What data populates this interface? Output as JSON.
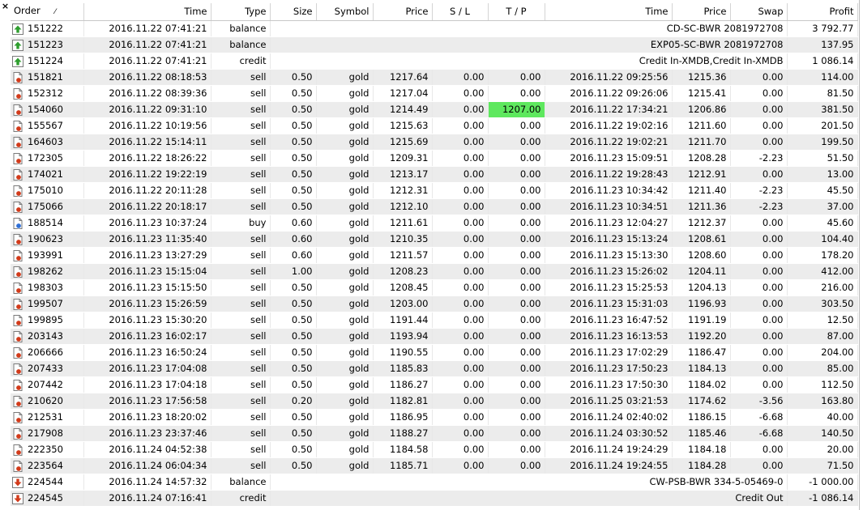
{
  "columns": {
    "order": "Order",
    "open_time": "Time",
    "type": "Type",
    "size": "Size",
    "symbol": "Symbol",
    "open_price": "Price",
    "sl": "S / L",
    "tp": "T / P",
    "close_time": "Time",
    "close_price": "Price",
    "swap": "Swap",
    "profit": "Profit"
  },
  "close_icon": "×",
  "rows": [
    {
      "kind": "balance-in",
      "order": "151222",
      "open_time": "2016.11.22 07:41:21",
      "type": "balance",
      "comment": "CD-SC-BWR 2081972708",
      "profit": "3 792.77"
    },
    {
      "kind": "balance-in",
      "order": "151223",
      "open_time": "2016.11.22 07:41:21",
      "type": "balance",
      "comment": "EXP05-SC-BWR 2081972708",
      "profit": "137.95"
    },
    {
      "kind": "balance-in",
      "order": "151224",
      "open_time": "2016.11.22 07:41:21",
      "type": "credit",
      "comment": "Credit In-XMDB,Credit In-XMDB",
      "profit": "1 086.14"
    },
    {
      "kind": "sell",
      "order": "151821",
      "open_time": "2016.11.22 08:18:53",
      "type": "sell",
      "size": "0.50",
      "symbol": "gold",
      "open_price": "1217.64",
      "sl": "0.00",
      "tp": "0.00",
      "close_time": "2016.11.22 09:25:56",
      "close_price": "1215.36",
      "swap": "0.00",
      "profit": "114.00"
    },
    {
      "kind": "sell",
      "order": "152312",
      "open_time": "2016.11.22 08:39:36",
      "type": "sell",
      "size": "0.50",
      "symbol": "gold",
      "open_price": "1217.04",
      "sl": "0.00",
      "tp": "0.00",
      "close_time": "2016.11.22 09:26:06",
      "close_price": "1215.41",
      "swap": "0.00",
      "profit": "81.50"
    },
    {
      "kind": "sell",
      "order": "154060",
      "open_time": "2016.11.22 09:31:10",
      "type": "sell",
      "size": "0.50",
      "symbol": "gold",
      "open_price": "1214.49",
      "sl": "0.00",
      "tp": "1207.00",
      "close_time": "2016.11.22 17:34:21",
      "close_price": "1206.86",
      "swap": "0.00",
      "profit": "381.50",
      "tp_hit": true
    },
    {
      "kind": "sell",
      "order": "155567",
      "open_time": "2016.11.22 10:19:56",
      "type": "sell",
      "size": "0.50",
      "symbol": "gold",
      "open_price": "1215.63",
      "sl": "0.00",
      "tp": "0.00",
      "close_time": "2016.11.22 19:02:16",
      "close_price": "1211.60",
      "swap": "0.00",
      "profit": "201.50"
    },
    {
      "kind": "sell",
      "order": "164603",
      "open_time": "2016.11.22 15:14:11",
      "type": "sell",
      "size": "0.50",
      "symbol": "gold",
      "open_price": "1215.69",
      "sl": "0.00",
      "tp": "0.00",
      "close_time": "2016.11.22 19:02:21",
      "close_price": "1211.70",
      "swap": "0.00",
      "profit": "199.50"
    },
    {
      "kind": "sell",
      "order": "172305",
      "open_time": "2016.11.22 18:26:22",
      "type": "sell",
      "size": "0.50",
      "symbol": "gold",
      "open_price": "1209.31",
      "sl": "0.00",
      "tp": "0.00",
      "close_time": "2016.11.23 15:09:51",
      "close_price": "1208.28",
      "swap": "-2.23",
      "profit": "51.50"
    },
    {
      "kind": "sell",
      "order": "174021",
      "open_time": "2016.11.22 19:22:19",
      "type": "sell",
      "size": "0.50",
      "symbol": "gold",
      "open_price": "1213.17",
      "sl": "0.00",
      "tp": "0.00",
      "close_time": "2016.11.22 19:28:43",
      "close_price": "1212.91",
      "swap": "0.00",
      "profit": "13.00"
    },
    {
      "kind": "sell",
      "order": "175010",
      "open_time": "2016.11.22 20:11:28",
      "type": "sell",
      "size": "0.50",
      "symbol": "gold",
      "open_price": "1212.31",
      "sl": "0.00",
      "tp": "0.00",
      "close_time": "2016.11.23 10:34:42",
      "close_price": "1211.40",
      "swap": "-2.23",
      "profit": "45.50"
    },
    {
      "kind": "sell",
      "order": "175066",
      "open_time": "2016.11.22 20:18:17",
      "type": "sell",
      "size": "0.50",
      "symbol": "gold",
      "open_price": "1212.10",
      "sl": "0.00",
      "tp": "0.00",
      "close_time": "2016.11.23 10:34:51",
      "close_price": "1211.36",
      "swap": "-2.23",
      "profit": "37.00"
    },
    {
      "kind": "buy",
      "order": "188514",
      "open_time": "2016.11.23 10:37:24",
      "type": "buy",
      "size": "0.60",
      "symbol": "gold",
      "open_price": "1211.61",
      "sl": "0.00",
      "tp": "0.00",
      "close_time": "2016.11.23 12:04:27",
      "close_price": "1212.37",
      "swap": "0.00",
      "profit": "45.60"
    },
    {
      "kind": "sell",
      "order": "190623",
      "open_time": "2016.11.23 11:35:40",
      "type": "sell",
      "size": "0.60",
      "symbol": "gold",
      "open_price": "1210.35",
      "sl": "0.00",
      "tp": "0.00",
      "close_time": "2016.11.23 15:13:24",
      "close_price": "1208.61",
      "swap": "0.00",
      "profit": "104.40"
    },
    {
      "kind": "sell",
      "order": "193991",
      "open_time": "2016.11.23 13:27:29",
      "type": "sell",
      "size": "0.60",
      "symbol": "gold",
      "open_price": "1211.57",
      "sl": "0.00",
      "tp": "0.00",
      "close_time": "2016.11.23 15:13:30",
      "close_price": "1208.60",
      "swap": "0.00",
      "profit": "178.20"
    },
    {
      "kind": "sell",
      "order": "198262",
      "open_time": "2016.11.23 15:15:04",
      "type": "sell",
      "size": "1.00",
      "symbol": "gold",
      "open_price": "1208.23",
      "sl": "0.00",
      "tp": "0.00",
      "close_time": "2016.11.23 15:26:02",
      "close_price": "1204.11",
      "swap": "0.00",
      "profit": "412.00"
    },
    {
      "kind": "sell",
      "order": "198303",
      "open_time": "2016.11.23 15:15:50",
      "type": "sell",
      "size": "0.50",
      "symbol": "gold",
      "open_price": "1208.45",
      "sl": "0.00",
      "tp": "0.00",
      "close_time": "2016.11.23 15:25:53",
      "close_price": "1204.13",
      "swap": "0.00",
      "profit": "216.00"
    },
    {
      "kind": "sell",
      "order": "199507",
      "open_time": "2016.11.23 15:26:59",
      "type": "sell",
      "size": "0.50",
      "symbol": "gold",
      "open_price": "1203.00",
      "sl": "0.00",
      "tp": "0.00",
      "close_time": "2016.11.23 15:31:03",
      "close_price": "1196.93",
      "swap": "0.00",
      "profit": "303.50"
    },
    {
      "kind": "sell",
      "order": "199895",
      "open_time": "2016.11.23 15:30:20",
      "type": "sell",
      "size": "0.50",
      "symbol": "gold",
      "open_price": "1191.44",
      "sl": "0.00",
      "tp": "0.00",
      "close_time": "2016.11.23 16:47:52",
      "close_price": "1191.19",
      "swap": "0.00",
      "profit": "12.50"
    },
    {
      "kind": "sell",
      "order": "203143",
      "open_time": "2016.11.23 16:02:17",
      "type": "sell",
      "size": "0.50",
      "symbol": "gold",
      "open_price": "1193.94",
      "sl": "0.00",
      "tp": "0.00",
      "close_time": "2016.11.23 16:13:53",
      "close_price": "1192.20",
      "swap": "0.00",
      "profit": "87.00"
    },
    {
      "kind": "sell",
      "order": "206666",
      "open_time": "2016.11.23 16:50:24",
      "type": "sell",
      "size": "0.50",
      "symbol": "gold",
      "open_price": "1190.55",
      "sl": "0.00",
      "tp": "0.00",
      "close_time": "2016.11.23 17:02:29",
      "close_price": "1186.47",
      "swap": "0.00",
      "profit": "204.00"
    },
    {
      "kind": "sell",
      "order": "207433",
      "open_time": "2016.11.23 17:04:08",
      "type": "sell",
      "size": "0.50",
      "symbol": "gold",
      "open_price": "1185.83",
      "sl": "0.00",
      "tp": "0.00",
      "close_time": "2016.11.23 17:50:23",
      "close_price": "1184.13",
      "swap": "0.00",
      "profit": "85.00"
    },
    {
      "kind": "sell",
      "order": "207442",
      "open_time": "2016.11.23 17:04:18",
      "type": "sell",
      "size": "0.50",
      "symbol": "gold",
      "open_price": "1186.27",
      "sl": "0.00",
      "tp": "0.00",
      "close_time": "2016.11.23 17:50:30",
      "close_price": "1184.02",
      "swap": "0.00",
      "profit": "112.50"
    },
    {
      "kind": "sell",
      "order": "210620",
      "open_time": "2016.11.23 17:56:58",
      "type": "sell",
      "size": "0.20",
      "symbol": "gold",
      "open_price": "1182.81",
      "sl": "0.00",
      "tp": "0.00",
      "close_time": "2016.11.25 03:21:53",
      "close_price": "1174.62",
      "swap": "-3.56",
      "profit": "163.80"
    },
    {
      "kind": "sell",
      "order": "212531",
      "open_time": "2016.11.23 18:20:02",
      "type": "sell",
      "size": "0.50",
      "symbol": "gold",
      "open_price": "1186.95",
      "sl": "0.00",
      "tp": "0.00",
      "close_time": "2016.11.24 02:40:02",
      "close_price": "1186.15",
      "swap": "-6.68",
      "profit": "40.00"
    },
    {
      "kind": "sell",
      "order": "217908",
      "open_time": "2016.11.23 23:37:46",
      "type": "sell",
      "size": "0.50",
      "symbol": "gold",
      "open_price": "1188.27",
      "sl": "0.00",
      "tp": "0.00",
      "close_time": "2016.11.24 03:30:52",
      "close_price": "1185.46",
      "swap": "-6.68",
      "profit": "140.50"
    },
    {
      "kind": "sell",
      "order": "222350",
      "open_time": "2016.11.24 04:52:38",
      "type": "sell",
      "size": "0.50",
      "symbol": "gold",
      "open_price": "1184.58",
      "sl": "0.00",
      "tp": "0.00",
      "close_time": "2016.11.24 19:24:29",
      "close_price": "1184.18",
      "swap": "0.00",
      "profit": "20.00"
    },
    {
      "kind": "sell",
      "order": "223564",
      "open_time": "2016.11.24 06:04:34",
      "type": "sell",
      "size": "0.50",
      "symbol": "gold",
      "open_price": "1185.71",
      "sl": "0.00",
      "tp": "0.00",
      "close_time": "2016.11.24 19:24:55",
      "close_price": "1184.28",
      "swap": "0.00",
      "profit": "71.50"
    },
    {
      "kind": "balance-out",
      "order": "224544",
      "open_time": "2016.11.24 14:57:32",
      "type": "balance",
      "comment": "CW-PSB-BWR 334-5-05469-0",
      "profit": "-1 000.00"
    },
    {
      "kind": "balance-out",
      "order": "224545",
      "open_time": "2016.11.24 07:16:41",
      "type": "credit",
      "comment": "Credit Out",
      "profit": "-1 086.14"
    }
  ],
  "colors": {
    "row_alt": "#ececec",
    "tp_highlight": "#5ee85e",
    "icon_up": "#2e9e2e",
    "icon_down": "#d23a1a",
    "icon_buy": "#2f6fd6"
  },
  "icons": {
    "balance-in": "deposit-up-arrow-icon",
    "balance-out": "withdrawal-down-arrow-icon",
    "sell": "sell-order-icon",
    "buy": "buy-order-icon"
  }
}
